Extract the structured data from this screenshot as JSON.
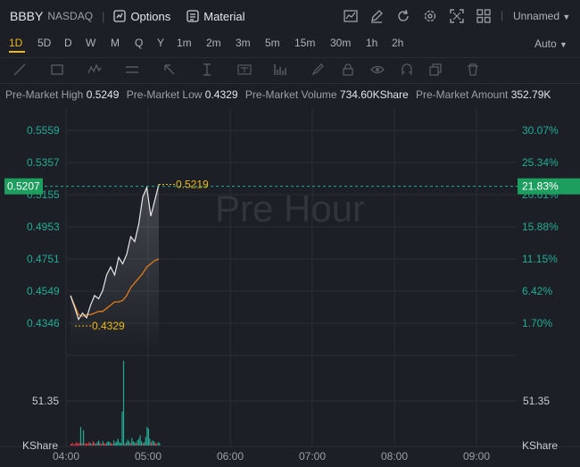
{
  "header": {
    "ticker": "BBBY",
    "exchange": "NASDAQ",
    "options_label": "Options",
    "material_label": "Material",
    "layout_name": "Unnamed",
    "icons": [
      "line-chart-icon",
      "edit-icon",
      "refresh-icon",
      "settings-icon",
      "expand-icon",
      "grid-icon"
    ]
  },
  "timeframes": [
    "1D",
    "5D",
    "D",
    "W",
    "M",
    "Q",
    "Y",
    "1m",
    "2m",
    "3m",
    "5m",
    "15m",
    "30m",
    "1h",
    "2h"
  ],
  "active_timeframe": "1D",
  "scale_mode": "Auto",
  "drawing_tools": [
    "trend-line-icon",
    "rectangle-icon",
    "wave-icon",
    "horizontal-line-icon",
    "arrow-icon",
    "vertical-line-icon",
    "text-icon",
    "volume-profile-icon",
    "brush-icon",
    "lock-icon",
    "eye-icon",
    "magnet-icon",
    "copy-icon",
    "trash-icon"
  ],
  "stats": {
    "pre_high_label": "Pre-Market High",
    "pre_high": "0.5249",
    "pre_low_label": "Pre-Market Low",
    "pre_low": "0.4329",
    "pre_volume_label": "Pre-Market Volume",
    "pre_volume": "734.60KShare",
    "pre_amount_label": "Pre-Market Amount",
    "pre_amount": "352.79K"
  },
  "watermark": "Pre Hour",
  "colors": {
    "up": "#22ab94",
    "down": "#f23645",
    "accent": "#f0b90b",
    "avg": "#e07b1a",
    "price_tag": "#1e9e5e"
  },
  "chart_data": {
    "type": "line",
    "x_ticks": [
      "04:00",
      "05:00",
      "06:00",
      "07:00",
      "08:00",
      "09:00"
    ],
    "y_ticks": [
      "0.5559",
      "0.5357",
      "0.5155",
      "0.4953",
      "0.4751",
      "0.4549",
      "0.4346"
    ],
    "pct_ticks": [
      "30.07%",
      "25.34%",
      "20.61%",
      "15.88%",
      "11.15%",
      "6.42%",
      "1.70%"
    ],
    "ylim": [
      0.4346,
      0.5559
    ],
    "current_price": "0.5207",
    "current_pct": "21.83%",
    "high_marker": "0.5219",
    "low_marker": "0.4329",
    "volume_label": "51.35",
    "volume_unit": "KShare",
    "series": [
      {
        "values": [
          0.452,
          0.445,
          0.437,
          0.441,
          0.438,
          0.446,
          0.452,
          0.45,
          0.455,
          0.465,
          0.47,
          0.465,
          0.476,
          0.472,
          0.478,
          0.489,
          0.486,
          0.497,
          0.514,
          0.52,
          0.502,
          0.512,
          0.5219
        ]
      },
      {
        "values": [
          0.452,
          0.446,
          0.44,
          0.439,
          0.44,
          0.44,
          0.441,
          0.442,
          0.442,
          0.444,
          0.446,
          0.448,
          0.448,
          0.449,
          0.452,
          0.457,
          0.46,
          0.463,
          0.466,
          0.47,
          0.472,
          0.474,
          0.475
        ]
      }
    ],
    "volume": [
      2,
      3,
      1,
      2,
      4,
      2,
      3,
      22,
      3,
      18,
      2,
      3,
      2,
      4,
      3,
      2,
      5,
      3,
      2,
      4,
      6,
      3,
      2,
      5,
      3,
      2,
      4,
      5,
      4,
      3,
      2,
      6,
      3,
      5,
      8,
      4,
      3,
      40,
      100,
      2,
      4,
      7,
      5,
      3,
      9,
      5,
      4,
      3,
      6,
      8,
      12,
      5,
      3,
      4,
      10,
      22,
      20,
      8,
      4,
      6,
      5,
      3,
      2,
      4,
      3
    ],
    "volume_up": [
      0,
      0,
      0,
      0,
      0,
      0,
      0,
      1,
      0,
      1,
      0,
      0,
      0,
      0,
      1,
      0,
      0,
      1,
      0,
      1,
      1,
      0,
      0,
      1,
      0,
      0,
      1,
      1,
      1,
      0,
      0,
      1,
      1,
      1,
      1,
      1,
      1,
      1,
      1,
      0,
      1,
      1,
      1,
      0,
      1,
      1,
      1,
      0,
      1,
      1,
      1,
      1,
      0,
      1,
      1,
      1,
      1,
      1,
      0,
      1,
      1,
      0,
      0,
      1,
      1
    ]
  }
}
